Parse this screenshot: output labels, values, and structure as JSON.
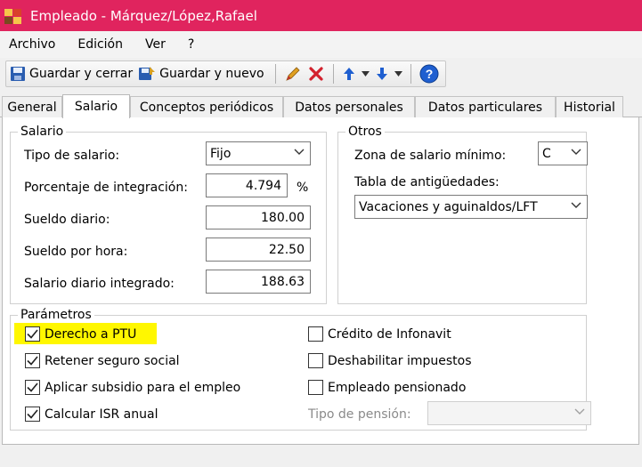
{
  "window": {
    "title": "Empleado - Márquez/López,Rafael"
  },
  "menu": [
    "Archivo",
    "Edición",
    "Ver",
    "?"
  ],
  "toolbar": {
    "save_close": "Guardar y cerrar",
    "save_new": "Guardar y nuevo"
  },
  "tabs": [
    {
      "label": "General",
      "active": false
    },
    {
      "label": "Salario",
      "active": true
    },
    {
      "label": "Conceptos periódicos",
      "active": false
    },
    {
      "label": "Datos personales",
      "active": false
    },
    {
      "label": "Datos particulares",
      "active": false
    },
    {
      "label": "Historial",
      "active": false
    }
  ],
  "salario": {
    "title": "Salario",
    "tipo_label": "Tipo de salario:",
    "tipo_value": "Fijo",
    "porcentaje_label": "Porcentaje de integración:",
    "porcentaje_value": "4.794",
    "porcentaje_unit": "%",
    "sueldo_diario_label": "Sueldo diario:",
    "sueldo_diario_value": "180.00",
    "sueldo_hora_label": "Sueldo por hora:",
    "sueldo_hora_value": "22.50",
    "sdi_label": "Salario diario integrado:",
    "sdi_value": "188.63"
  },
  "otros": {
    "title": "Otros",
    "zona_label": "Zona de salario mínimo:",
    "zona_value": "C",
    "tabla_label": "Tabla de antigüedades:",
    "tabla_value": "Vacaciones y aguinaldos/LFT"
  },
  "parametros": {
    "title": "Parámetros",
    "derecho_ptu": {
      "label": "Derecho a PTU",
      "checked": true
    },
    "retener_seguro": {
      "label": "Retener seguro social",
      "checked": true
    },
    "aplicar_subsidio": {
      "label": "Aplicar subsidio para el empleo",
      "checked": true
    },
    "calcular_isr": {
      "label": "Calcular ISR anual",
      "checked": true
    },
    "credito_infonavit": {
      "label": "Crédito de Infonavit",
      "checked": false
    },
    "deshabilitar_impuestos": {
      "label": "Deshabilitar impuestos",
      "checked": false
    },
    "empleado_pensionado": {
      "label": "Empleado pensionado",
      "checked": false
    },
    "tipo_pension_label": "Tipo de pensión:",
    "tipo_pension_value": ""
  },
  "colors": {
    "titlebar": "#e0245e",
    "highlight": "#fff700",
    "accent": "#1f5fd0"
  }
}
